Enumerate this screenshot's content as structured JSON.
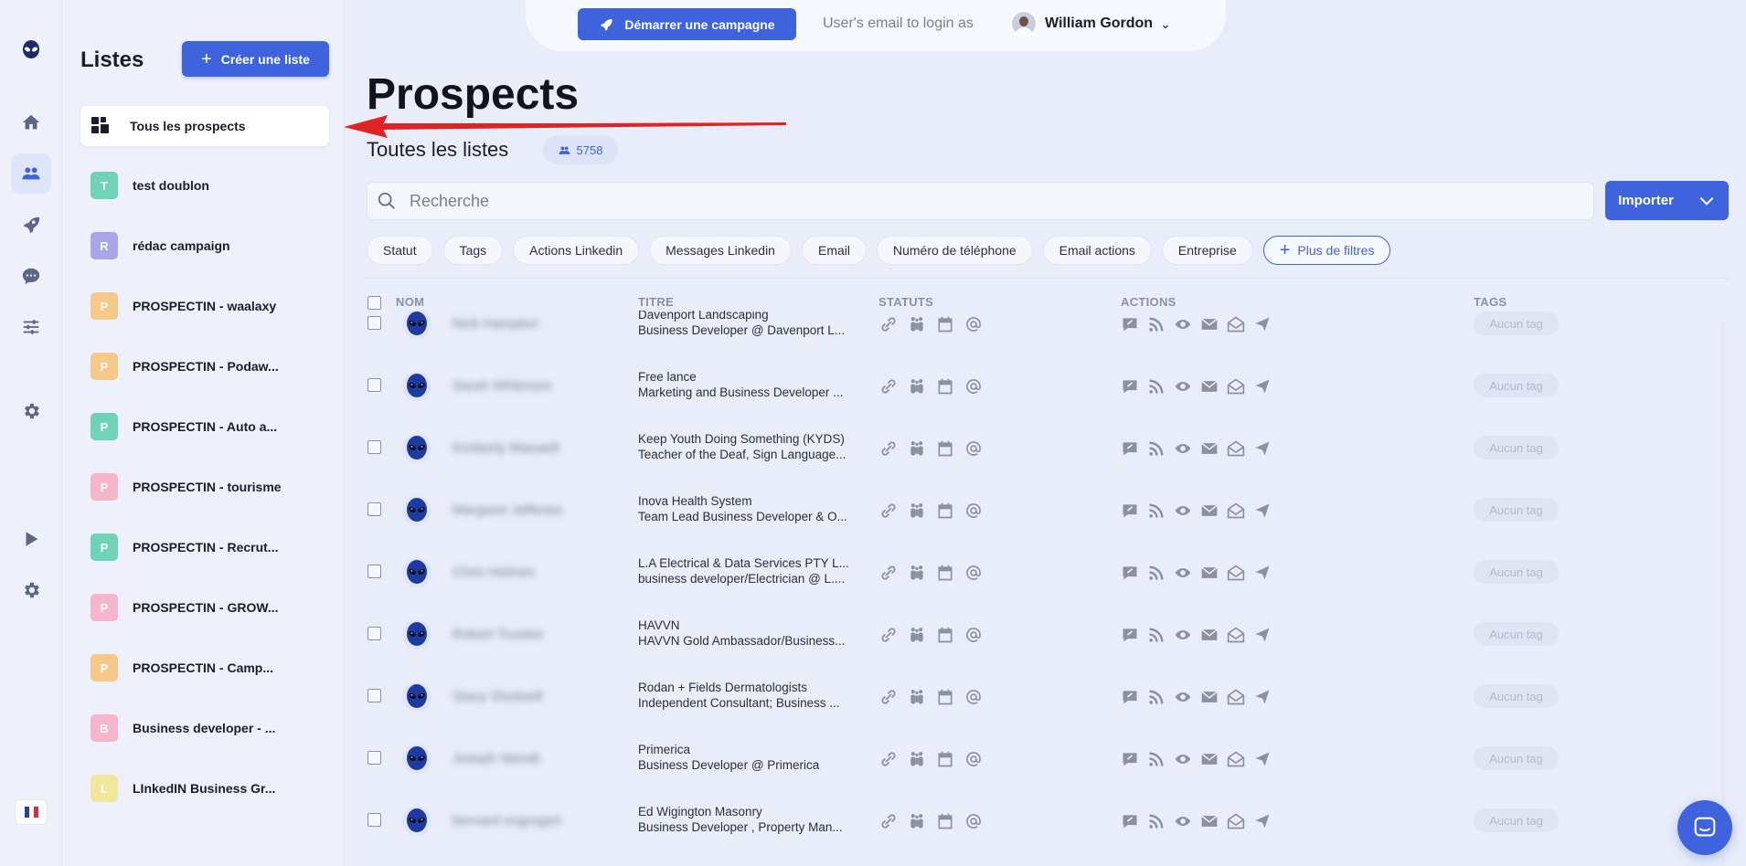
{
  "topbar": {
    "start_campaign_label": "Démarrer une campagne",
    "login_as_text": "User's email to login as",
    "user_name": "William Gordon"
  },
  "sidebar": {
    "items": [
      "logo",
      "home",
      "prospects",
      "campaigns",
      "messages",
      "filters",
      "settings",
      "play",
      "settings"
    ],
    "language_flag": "FR"
  },
  "lists_panel": {
    "title": "Listes",
    "create_label": "Créer une liste",
    "all_prospects_label": "Tous les prospects",
    "lists": [
      {
        "initial": "T",
        "name": "test doublon",
        "color": "#6fd3b8"
      },
      {
        "initial": "R",
        "name": "rédac campaign",
        "color": "#a9a7ea"
      },
      {
        "initial": "P",
        "name": "PROSPECTIN - waalaxy",
        "color": "#f6c989"
      },
      {
        "initial": "P",
        "name": "PROSPECTIN - Podaw...",
        "color": "#f6c989"
      },
      {
        "initial": "P",
        "name": "PROSPECTIN - Auto a...",
        "color": "#6fd3b8"
      },
      {
        "initial": "P",
        "name": "PROSPECTIN - tourisme",
        "color": "#f7b5cc"
      },
      {
        "initial": "P",
        "name": "PROSPECTIN - Recrut...",
        "color": "#6fd3b8"
      },
      {
        "initial": "P",
        "name": "PROSPECTIN - GROW...",
        "color": "#f7b5cc"
      },
      {
        "initial": "P",
        "name": "PROSPECTIN - Camp...",
        "color": "#f6c989"
      },
      {
        "initial": "B",
        "name": "Business developer - ...",
        "color": "#f7b5cc"
      },
      {
        "initial": "L",
        "name": "LInkedIN Business Gr...",
        "color": "#f1e79a"
      }
    ]
  },
  "main": {
    "title": "Prospects",
    "subtitle": "Toutes les listes",
    "count": "5758",
    "search_placeholder": "Recherche",
    "import_label": "Importer",
    "filters": [
      "Statut",
      "Tags",
      "Actions Linkedin",
      "Messages Linkedin",
      "Email",
      "Numéro de téléphone",
      "Email actions",
      "Entreprise"
    ],
    "more_filters_label": "Plus de filtres",
    "columns": {
      "name": "NOM",
      "title": "TITRE",
      "status": "STATUTS",
      "actions": "ACTIONS",
      "tags": "TAGS"
    },
    "rows": [
      {
        "name": "Nick Hampton",
        "line1": "Davenport Landscaping",
        "line2": "Business Developer @ Davenport L...",
        "tag": "Aucun tag"
      },
      {
        "name": "Sarah Whitmore",
        "line1": "Free lance",
        "line2": "Marketing and Business Developer ...",
        "tag": "Aucun tag"
      },
      {
        "name": "Kimberly Maxwell",
        "line1": "Keep Youth Doing Something (KYDS)",
        "line2": "Teacher of the Deaf, Sign Language...",
        "tag": "Aucun tag"
      },
      {
        "name": "Margaret Jefferies",
        "line1": "Inova Health System",
        "line2": "Team Lead Business Developer & O...",
        "tag": "Aucun tag"
      },
      {
        "name": "Chris Holmes",
        "line1": "L.A Electrical & Data Services PTY L...",
        "line2": "business developer/Electrician @ L....",
        "tag": "Aucun tag"
      },
      {
        "name": "Robert Trustee",
        "line1": "HAVVN",
        "line2": "HAVVN Gold Ambassador/Business...",
        "tag": "Aucun tag"
      },
      {
        "name": "Stacy Shotwell",
        "line1": "Rodan + Fields Dermatologists",
        "line2": "Independent Consultant; Business ...",
        "tag": "Aucun tag"
      },
      {
        "name": "Joseph Wendt",
        "line1": "Primerica",
        "line2": "Business Developer @ Primerica",
        "tag": "Aucun tag"
      },
      {
        "name": "bernard engrogeri",
        "line1": "Ed Wigington Masonry",
        "line2": "Business Developer , Property Man...",
        "tag": "Aucun tag"
      }
    ]
  },
  "colors": {
    "accent": "#3e63dd",
    "arrow": "#e02424"
  }
}
